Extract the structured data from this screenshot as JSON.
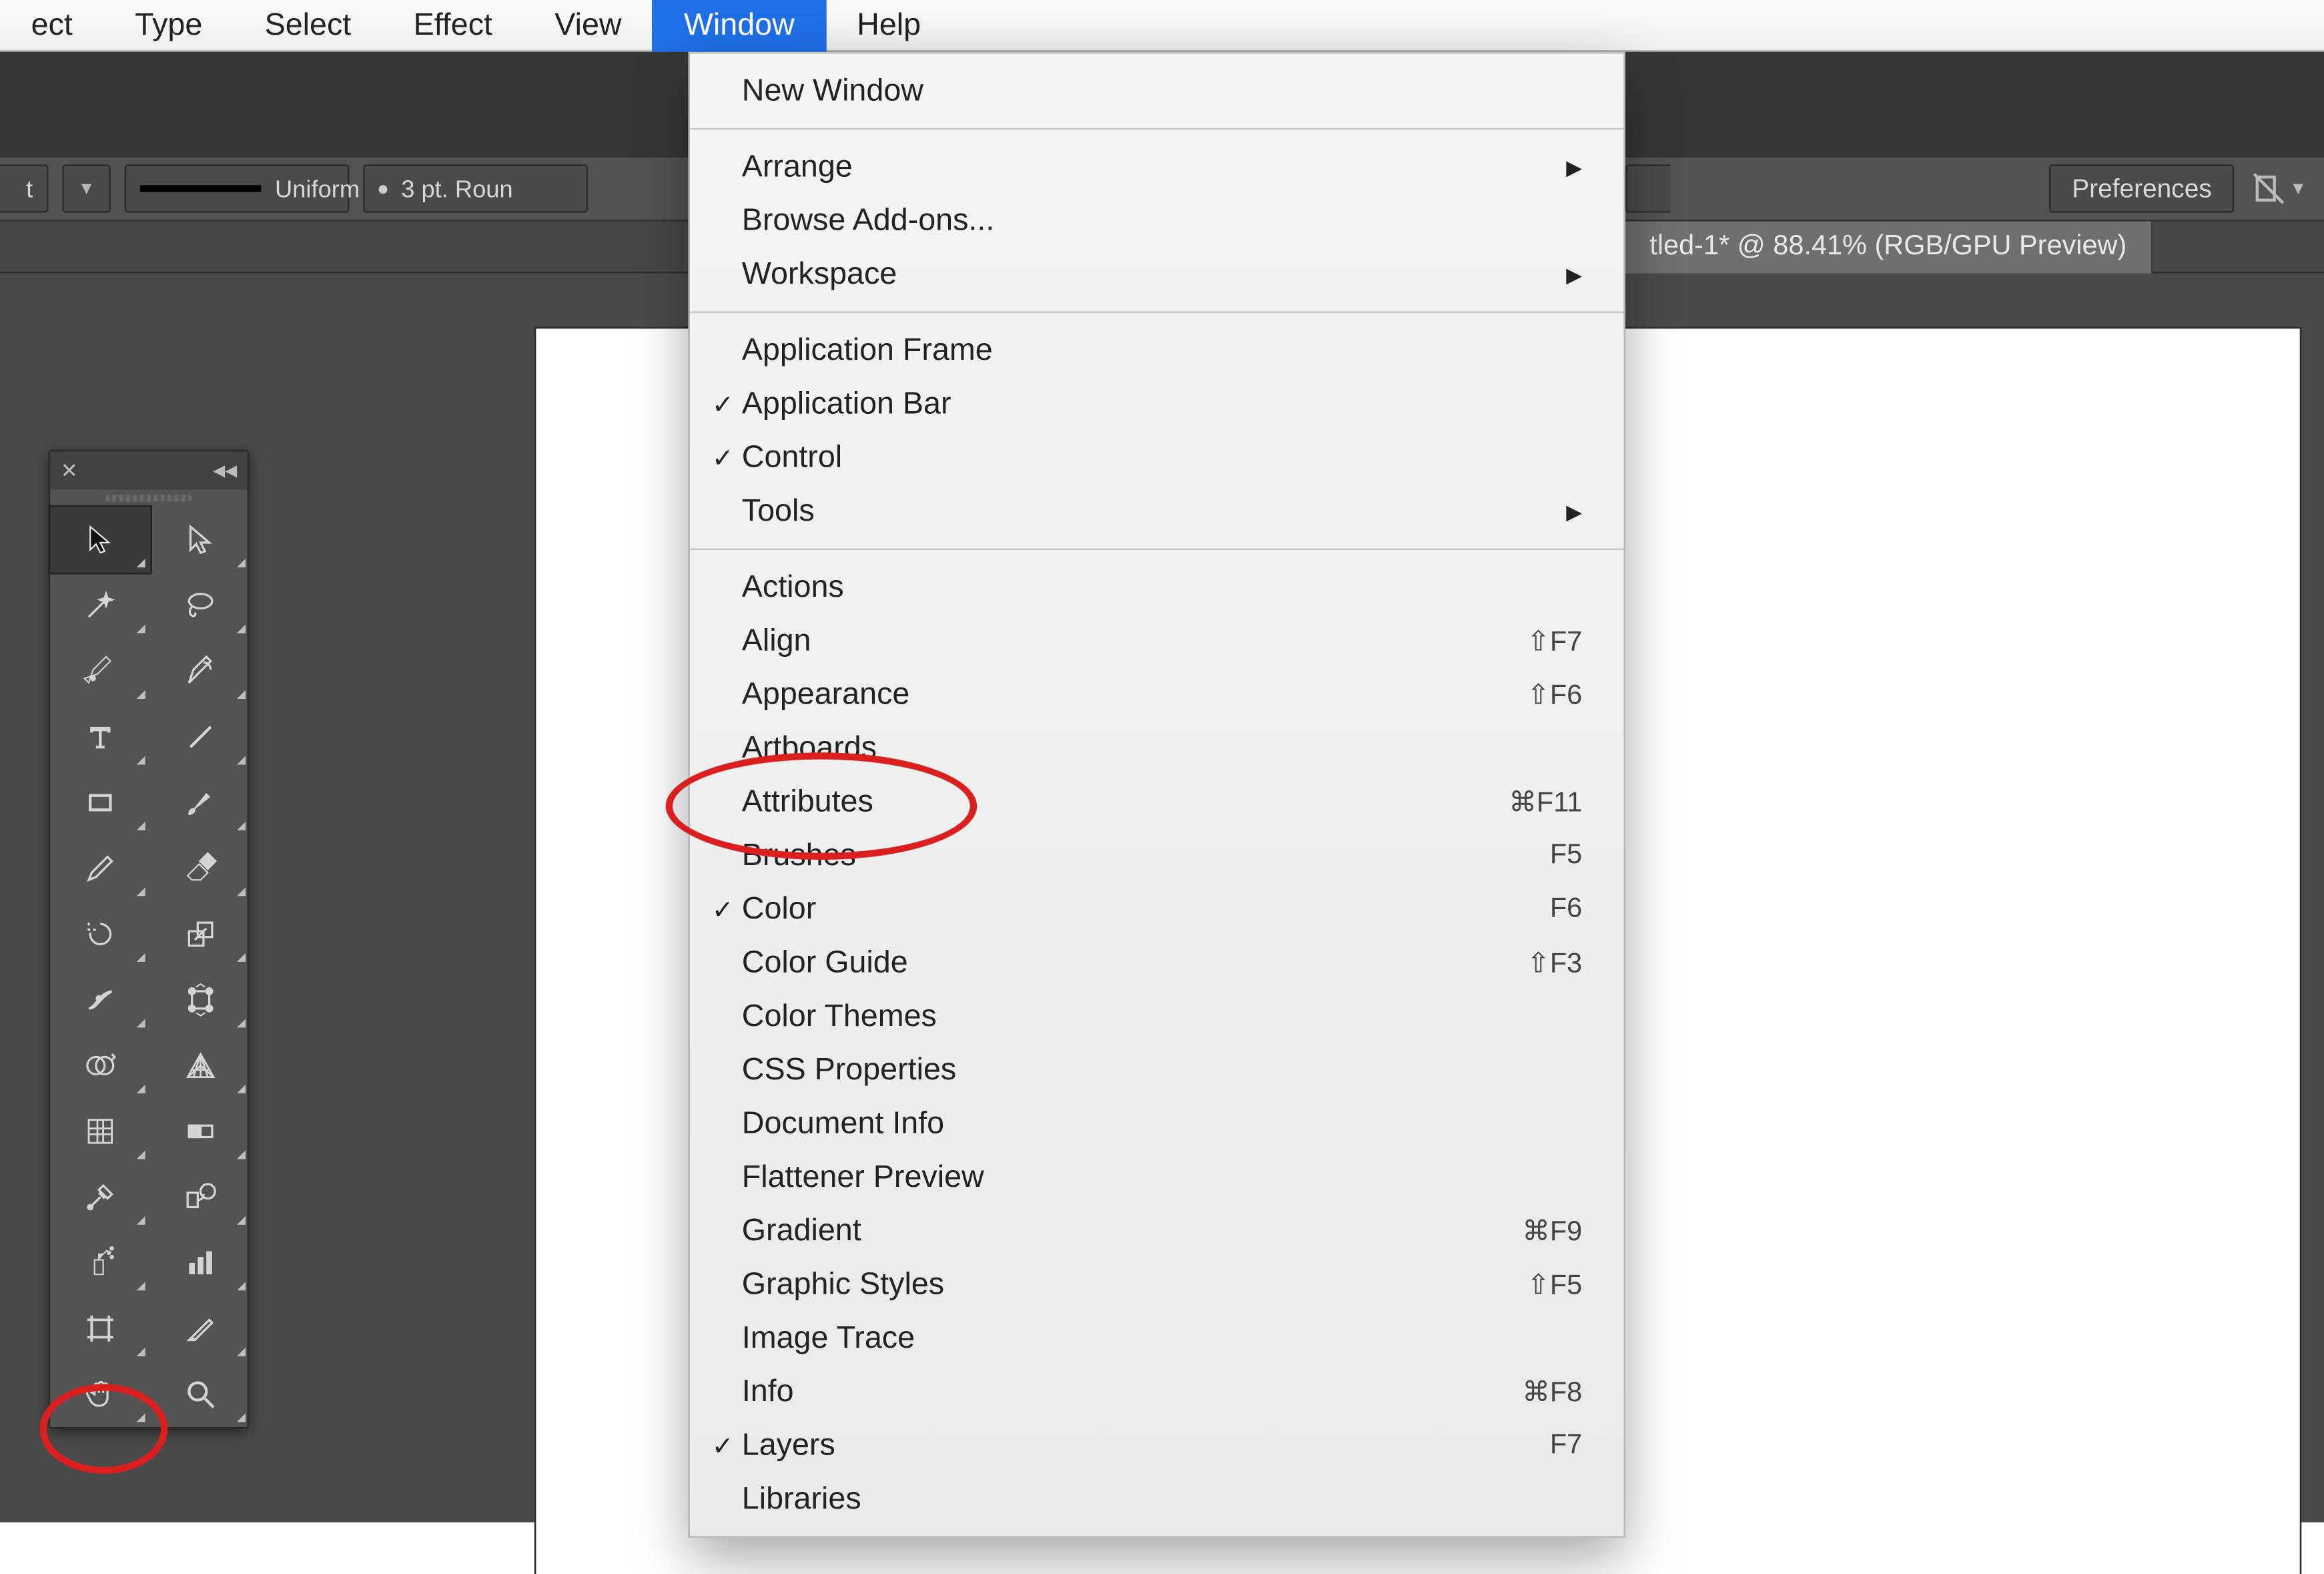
{
  "menubar": {
    "items": [
      {
        "label": "ect"
      },
      {
        "label": "Type"
      },
      {
        "label": "Select"
      },
      {
        "label": "Effect"
      },
      {
        "label": "View"
      },
      {
        "label": "Window"
      },
      {
        "label": "Help"
      }
    ],
    "activeIndex": 5
  },
  "controlBar": {
    "truncatedLeft": "t",
    "strokeStyle": "Uniform",
    "brushPreset": "3 pt. Roun",
    "preferencesLabel": "Preferences"
  },
  "documentTab": {
    "title": "tled-1* @ 88.41% (RGB/GPU Preview)"
  },
  "windowMenu": {
    "groups": [
      [
        {
          "label": "New Window"
        }
      ],
      [
        {
          "label": "Arrange",
          "submenu": true
        },
        {
          "label": "Browse Add-ons..."
        },
        {
          "label": "Workspace",
          "submenu": true
        }
      ],
      [
        {
          "label": "Application Frame"
        },
        {
          "label": "Application Bar",
          "checked": true
        },
        {
          "label": "Control",
          "checked": true
        },
        {
          "label": "Tools",
          "submenu": true
        }
      ],
      [
        {
          "label": "Actions"
        },
        {
          "label": "Align",
          "shortcut": "⇧F7"
        },
        {
          "label": "Appearance",
          "shortcut": "⇧F6"
        },
        {
          "label": "Artboards"
        },
        {
          "label": "Attributes",
          "shortcut": "⌘F11"
        },
        {
          "label": "Brushes",
          "shortcut": "F5"
        },
        {
          "label": "Color",
          "checked": true,
          "shortcut": "F6"
        },
        {
          "label": "Color Guide",
          "shortcut": "⇧F3"
        },
        {
          "label": "Color Themes"
        },
        {
          "label": "CSS Properties"
        },
        {
          "label": "Document Info"
        },
        {
          "label": "Flattener Preview"
        },
        {
          "label": "Gradient",
          "shortcut": "⌘F9"
        },
        {
          "label": "Graphic Styles",
          "shortcut": "⇧F5"
        },
        {
          "label": "Image Trace"
        },
        {
          "label": "Info",
          "shortcut": "⌘F8"
        },
        {
          "label": "Layers",
          "checked": true,
          "shortcut": "F7"
        },
        {
          "label": "Libraries"
        }
      ]
    ]
  },
  "toolPanel": {
    "tools": [
      {
        "name": "selection-tool",
        "selected": true
      },
      {
        "name": "direct-selection-tool"
      },
      {
        "name": "magic-wand-tool"
      },
      {
        "name": "lasso-tool"
      },
      {
        "name": "pen-tool"
      },
      {
        "name": "curvature-tool"
      },
      {
        "name": "type-tool"
      },
      {
        "name": "line-segment-tool"
      },
      {
        "name": "rectangle-tool"
      },
      {
        "name": "paintbrush-tool"
      },
      {
        "name": "pencil-tool"
      },
      {
        "name": "eraser-tool"
      },
      {
        "name": "rotate-tool"
      },
      {
        "name": "scale-tool"
      },
      {
        "name": "width-tool"
      },
      {
        "name": "free-transform-tool"
      },
      {
        "name": "shape-builder-tool"
      },
      {
        "name": "perspective-grid-tool"
      },
      {
        "name": "mesh-tool"
      },
      {
        "name": "gradient-tool"
      },
      {
        "name": "eyedropper-tool"
      },
      {
        "name": "blend-tool"
      },
      {
        "name": "symbol-sprayer-tool"
      },
      {
        "name": "column-graph-tool"
      },
      {
        "name": "artboard-tool"
      },
      {
        "name": "slice-tool"
      },
      {
        "name": "hand-tool"
      },
      {
        "name": "zoom-tool"
      }
    ]
  }
}
